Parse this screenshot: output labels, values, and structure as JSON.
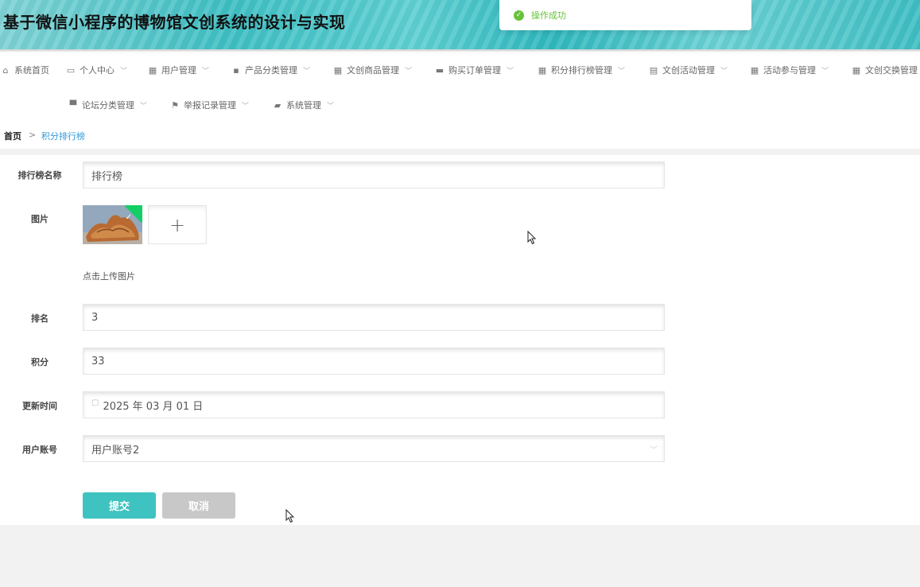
{
  "app": {
    "title": "基于微信小程序的博物馆文创系统的设计与实现"
  },
  "toast": {
    "message": "操作成功",
    "status_color": "#67c23a"
  },
  "nav": {
    "items": [
      {
        "label": "系统首页",
        "icon": "home-icon"
      },
      {
        "label": "个人中心",
        "icon": "card-icon"
      },
      {
        "label": "用户管理",
        "icon": "grid-icon"
      },
      {
        "label": "产品分类管理",
        "icon": "chat-icon"
      },
      {
        "label": "文创商品管理",
        "icon": "grid-icon"
      },
      {
        "label": "购买订单管理",
        "icon": "briefcase-icon"
      },
      {
        "label": "积分排行榜管理",
        "icon": "grid-icon"
      },
      {
        "label": "文创活动管理",
        "icon": "clipboard-icon"
      },
      {
        "label": "活动参与管理",
        "icon": "grid-icon"
      },
      {
        "label": "文创交换管理",
        "icon": "apps-icon"
      },
      {
        "label": "论坛分类管理",
        "icon": "monitor-icon"
      },
      {
        "label": "举报记录管理",
        "icon": "flag-icon"
      },
      {
        "label": "系统管理",
        "icon": "gear-icon"
      }
    ]
  },
  "breadcrumb": {
    "home": "首页",
    "separator": ">",
    "current": "积分排行榜"
  },
  "form": {
    "name": {
      "label": "排行榜名称",
      "value": "排行榜"
    },
    "image": {
      "label": "图片",
      "hint": "点击上传图片"
    },
    "rank": {
      "label": "排名",
      "value": "3"
    },
    "points": {
      "label": "积分",
      "value": "33"
    },
    "updated": {
      "label": "更新时间",
      "value": "2025 年 03 月 01 日"
    },
    "account": {
      "label": "用户账号",
      "value": "用户账号2"
    },
    "submit_label": "提交",
    "cancel_label": "取消"
  },
  "colors": {
    "accent": "#3fc3c0",
    "link": "#2e9bd6",
    "success": "#67c23a"
  }
}
